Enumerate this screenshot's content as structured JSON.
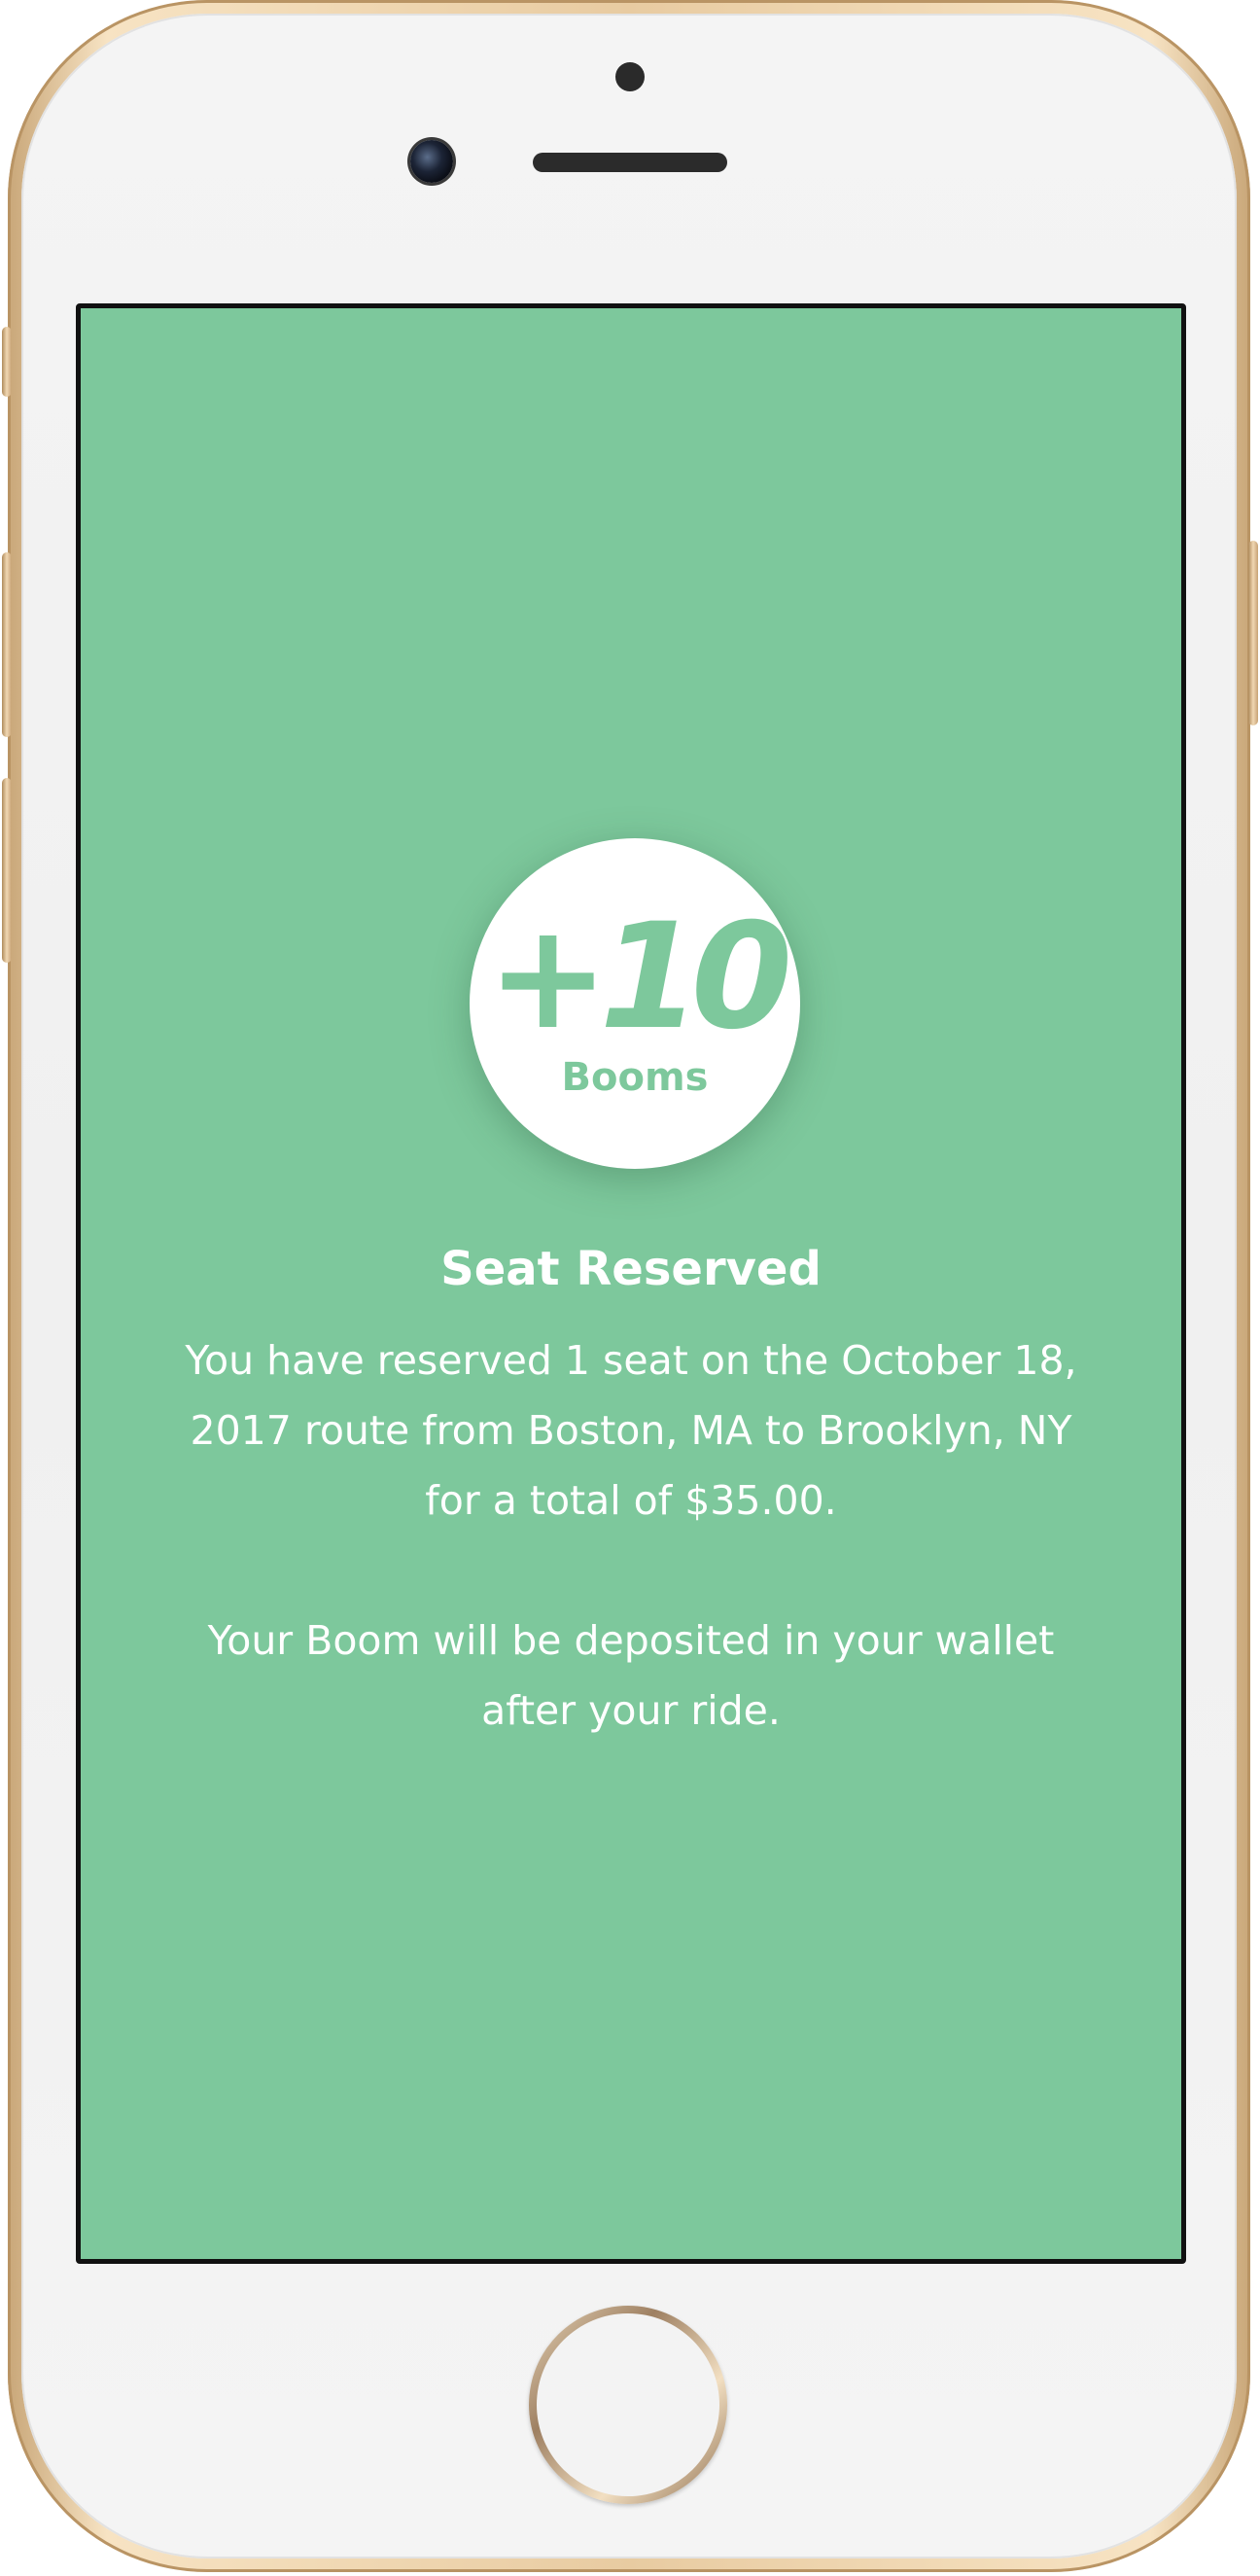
{
  "device": {
    "frame_color": "#e8cba1",
    "screen_background": "#7dc89c"
  },
  "reward_badge": {
    "amount": "+10",
    "unit": "Booms",
    "accent_color": "#7dc89c"
  },
  "confirmation": {
    "title": "Seat Reserved",
    "message": "You have reserved 1 seat on the October 18,\n2017 route from Boston, MA to Brooklyn, NY\nfor a total of $35.00.",
    "note": "Your Boom will be deposited in your wallet\nafter your ride."
  },
  "icons": [
    "front-camera-icon",
    "earpiece-speaker-icon",
    "home-button-icon"
  ]
}
